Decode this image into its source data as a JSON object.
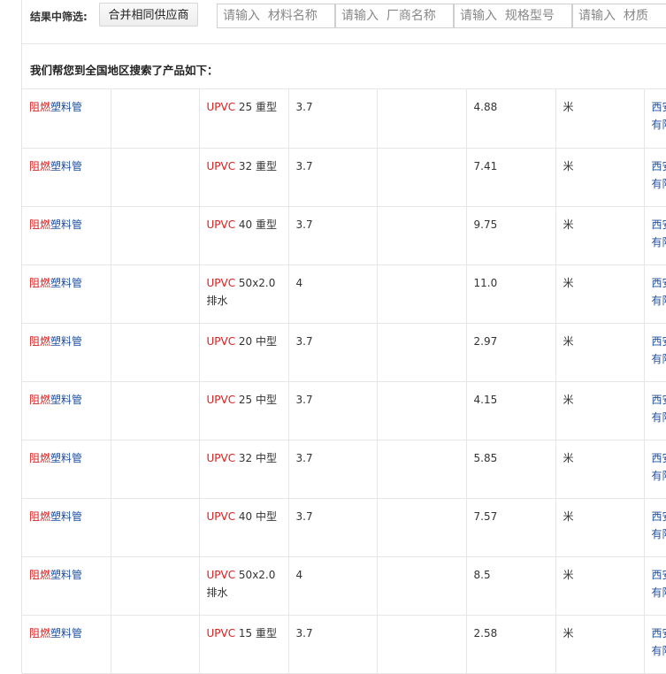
{
  "filter": {
    "label": "结果中筛选:",
    "merge_button": "合并相同供应商",
    "inputs": [
      {
        "placeholder": "请输入  材料名称"
      },
      {
        "placeholder": "请输入  厂商名称"
      },
      {
        "placeholder": "请输入  规格型号"
      },
      {
        "placeholder": "请输入  材质"
      }
    ]
  },
  "results_heading": "我们帮您到全国地区搜索了产品如下：",
  "rows": [
    {
      "name_hl": "阻燃",
      "name_rest": "塑料管",
      "spec_hl": "UPVC",
      "spec_rest": " 25  重型",
      "spec_line2": "",
      "tax": "3.7",
      "price": "4.88",
      "unit": "米",
      "supplier_l1": "西安",
      "supplier_l2": "有限"
    },
    {
      "name_hl": "阻燃",
      "name_rest": "塑料管",
      "spec_hl": "UPVC",
      "spec_rest": " 32  重型",
      "spec_line2": "",
      "tax": "3.7",
      "price": "7.41",
      "unit": "米",
      "supplier_l1": "西安",
      "supplier_l2": "有限"
    },
    {
      "name_hl": "阻燃",
      "name_rest": "塑料管",
      "spec_hl": "UPVC",
      "spec_rest": " 40  重型",
      "spec_line2": "",
      "tax": "3.7",
      "price": "9.75",
      "unit": "米",
      "supplier_l1": "西安",
      "supplier_l2": "有限"
    },
    {
      "name_hl": "阻燃",
      "name_rest": "塑料管",
      "spec_hl": "UPVC",
      "spec_rest": " 50x2.0",
      "spec_line2": "排水",
      "tax": "4",
      "price": "11.0",
      "unit": "米",
      "supplier_l1": "西安",
      "supplier_l2": "有限"
    },
    {
      "name_hl": "阻燃",
      "name_rest": "塑料管",
      "spec_hl": "UPVC",
      "spec_rest": " 20  中型",
      "spec_line2": "",
      "tax": "3.7",
      "price": "2.97",
      "unit": "米",
      "supplier_l1": "西安",
      "supplier_l2": "有限"
    },
    {
      "name_hl": "阻燃",
      "name_rest": "塑料管",
      "spec_hl": "UPVC",
      "spec_rest": " 25  中型",
      "spec_line2": "",
      "tax": "3.7",
      "price": "4.15",
      "unit": "米",
      "supplier_l1": "西安",
      "supplier_l2": "有限"
    },
    {
      "name_hl": "阻燃",
      "name_rest": "塑料管",
      "spec_hl": "UPVC",
      "spec_rest": " 32  中型",
      "spec_line2": "",
      "tax": "3.7",
      "price": "5.85",
      "unit": "米",
      "supplier_l1": "西安",
      "supplier_l2": "有限"
    },
    {
      "name_hl": "阻燃",
      "name_rest": "塑料管",
      "spec_hl": "UPVC",
      "spec_rest": " 40  中型",
      "spec_line2": "",
      "tax": "3.7",
      "price": "7.57",
      "unit": "米",
      "supplier_l1": "西安",
      "supplier_l2": "有限"
    },
    {
      "name_hl": "阻燃",
      "name_rest": "塑料管",
      "spec_hl": "UPVC",
      "spec_rest": " 50x2.0",
      "spec_line2": "排水",
      "tax": "4",
      "price": "8.5",
      "unit": "米",
      "supplier_l1": "西安",
      "supplier_l2": "有限"
    },
    {
      "name_hl": "阻燃",
      "name_rest": "塑料管",
      "spec_hl": "UPVC",
      "spec_rest": " 15  重型",
      "spec_line2": "",
      "tax": "3.7",
      "price": "2.58",
      "unit": "米",
      "supplier_l1": "西安",
      "supplier_l2": "有限"
    }
  ],
  "colors": {
    "highlight": "#d42222",
    "link": "#1f4f9e",
    "border": "#e6e6e6"
  }
}
